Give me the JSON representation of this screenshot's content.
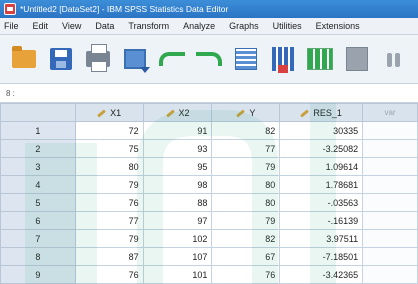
{
  "window": {
    "title": "*Untitled2 [DataSet2] - IBM SPSS Statistics Data Editor"
  },
  "menu": {
    "items": [
      "File",
      "Edit",
      "View",
      "Data",
      "Transform",
      "Analyze",
      "Graphs",
      "Utilities",
      "Extensions"
    ]
  },
  "toolbar": {
    "buttons": [
      "open-icon",
      "save-icon",
      "print-icon",
      "recall-dialog-icon",
      "undo-icon",
      "redo-icon",
      "goto-case-icon",
      "variables-icon",
      "find-icon",
      "split-file-icon",
      "binoculars-icon"
    ]
  },
  "cell_ref": {
    "text": "8 :"
  },
  "grid": {
    "columns": [
      "X1",
      "X2",
      "Y",
      "RES_1",
      "var"
    ],
    "rows": [
      {
        "n": "1",
        "cells": [
          "72",
          "91",
          "82",
          "30335"
        ]
      },
      {
        "n": "2",
        "cells": [
          "75",
          "93",
          "77",
          "-3.25082"
        ]
      },
      {
        "n": "3",
        "cells": [
          "80",
          "95",
          "79",
          "1.09614"
        ]
      },
      {
        "n": "4",
        "cells": [
          "79",
          "98",
          "80",
          "1.78681"
        ]
      },
      {
        "n": "5",
        "cells": [
          "76",
          "88",
          "80",
          "-.03563"
        ]
      },
      {
        "n": "6",
        "cells": [
          "77",
          "97",
          "79",
          "-.16139"
        ]
      },
      {
        "n": "7",
        "cells": [
          "79",
          "102",
          "82",
          "3.97511"
        ]
      },
      {
        "n": "8",
        "cells": [
          "87",
          "107",
          "67",
          "-7.18501"
        ]
      },
      {
        "n": "9",
        "cells": [
          "76",
          "101",
          "76",
          "-3.42365"
        ]
      }
    ]
  },
  "colors": {
    "title_bar": "#2a74c4",
    "header_bg": "#d9e3ee",
    "watermark": "#e4f3ef"
  }
}
